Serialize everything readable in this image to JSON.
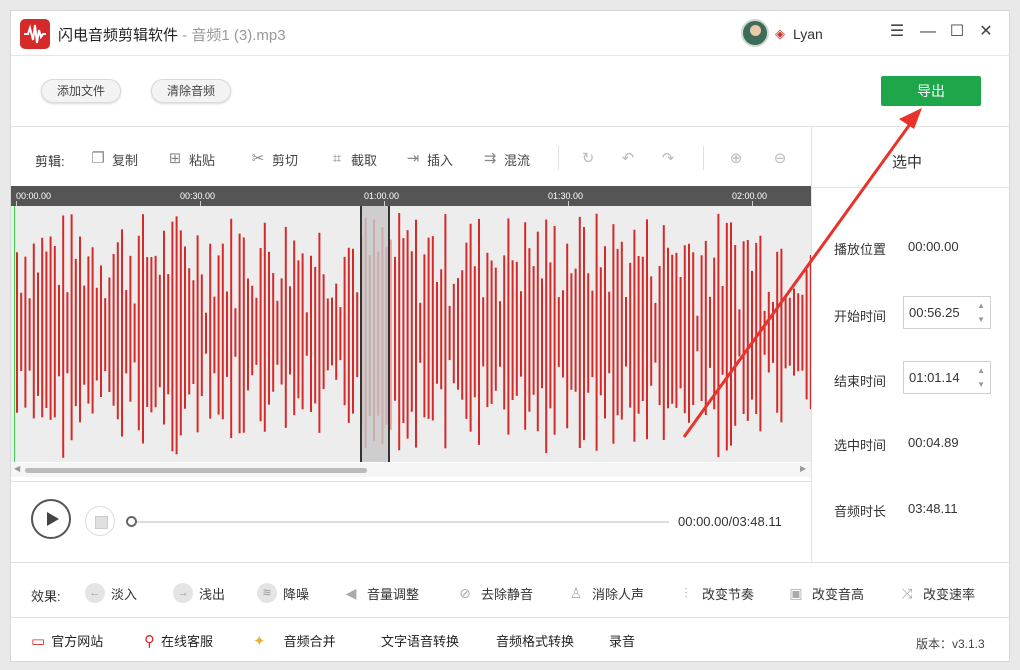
{
  "window": {
    "app_name": "闪电音频剪辑软件",
    "separator": " - ",
    "file_name": "音频1 (3).mp3",
    "user_name": "Lyan"
  },
  "window_controls": {
    "menu": "☰",
    "minimize": "—",
    "maximize": "☐",
    "close": "✕"
  },
  "toolbar": {
    "add_file": "添加文件",
    "clear_audio": "清除音频",
    "export": "导出"
  },
  "edit": {
    "label": "剪辑:",
    "tools": [
      {
        "label": "复制",
        "icon": "copy-icon"
      },
      {
        "label": "粘贴",
        "icon": "paste-icon"
      },
      {
        "label": "剪切",
        "icon": "scissors-icon"
      },
      {
        "label": "截取",
        "icon": "crop-icon"
      },
      {
        "label": "插入",
        "icon": "insert-icon"
      },
      {
        "label": "混流",
        "icon": "mix-icon"
      }
    ]
  },
  "timeline": {
    "ticks": [
      "00:00.00",
      "00:30.00",
      "01:00.00",
      "01:30.00",
      "02:00.00"
    ]
  },
  "waveform": {
    "color": "#d42a2a",
    "selected_color": "#e8a0a0",
    "playhead_color": "#3bd14d"
  },
  "playback": {
    "time": "00:00.00/03:48.11",
    "progress": 0.0
  },
  "panel": {
    "title": "选中",
    "play_position_label": "播放位置",
    "play_position": "00:00.00",
    "start_label": "开始时间",
    "start": "00:56.25",
    "end_label": "结束时间",
    "end": "01:01.14",
    "selected_label": "选中时间",
    "selected": "00:04.89",
    "duration_label": "音频时长",
    "duration": "03:48.11"
  },
  "effects": {
    "label": "效果:",
    "items": [
      {
        "label": "淡入",
        "icon": "fade-in-icon"
      },
      {
        "label": "浅出",
        "icon": "fade-out-icon"
      },
      {
        "label": "降噪",
        "icon": "denoise-icon"
      },
      {
        "label": "音量调整",
        "icon": "volume-icon"
      },
      {
        "label": "去除静音",
        "icon": "mute-remove-icon"
      },
      {
        "label": "消除人声",
        "icon": "vocal-remove-icon"
      },
      {
        "label": "改变节奏",
        "icon": "tempo-icon"
      },
      {
        "label": "改变音高",
        "icon": "pitch-icon"
      },
      {
        "label": "改变速率",
        "icon": "speed-icon"
      }
    ]
  },
  "footer": {
    "website": "官方网站",
    "support": "在线客服",
    "merge": "音频合并",
    "tts": "文字语音转换",
    "format": "音频格式转换",
    "record": "录音",
    "version": "版本：v3.1.3"
  },
  "colors": {
    "accent": "#1ea64a",
    "brand": "#d42a2a",
    "annotation": "#e8322a"
  }
}
